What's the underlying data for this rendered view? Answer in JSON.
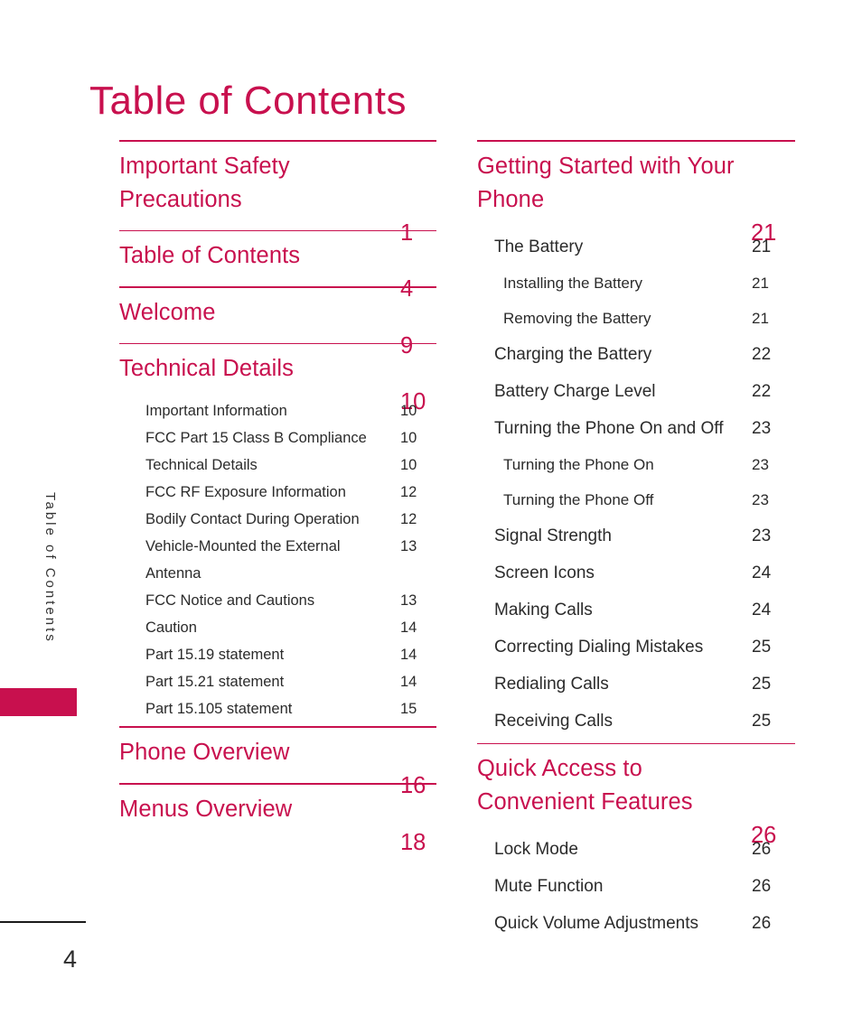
{
  "page": {
    "title": "Table of Contents",
    "side_tab_label": "Table of Contents",
    "folio": "4",
    "accent_color": "#C8104E",
    "text_color": "#2b2b2b"
  },
  "left_column": {
    "sections": [
      {
        "title": "Important Safety Precautions",
        "page": "1",
        "entries": []
      },
      {
        "title": "Table of Contents",
        "page": "4",
        "entries": []
      },
      {
        "title": "Welcome",
        "page": "9",
        "entries": []
      },
      {
        "title": "Technical Details",
        "page": "10",
        "entries": [
          {
            "label": "Important Information",
            "page": "10"
          },
          {
            "label": "FCC Part 15 Class B Compliance",
            "page": "10"
          },
          {
            "label": "Technical Details",
            "page": "10"
          },
          {
            "label": "FCC RF Exposure Information",
            "page": "12"
          },
          {
            "label": "Bodily Contact During Operation",
            "page": "12"
          },
          {
            "label": "Vehicle-Mounted the External Antenna",
            "page": "13"
          },
          {
            "label": "FCC Notice and Cautions",
            "page": "13"
          },
          {
            "label": "Caution",
            "page": "14"
          },
          {
            "label": "Part 15.19 statement",
            "page": "14"
          },
          {
            "label": "Part 15.21 statement",
            "page": "14"
          },
          {
            "label": "Part 15.105 statement",
            "page": "15"
          }
        ]
      },
      {
        "title": "Phone Overview",
        "page": "16",
        "entries": []
      },
      {
        "title": "Menus Overview",
        "page": "18",
        "entries": []
      }
    ]
  },
  "right_column": {
    "sections": [
      {
        "title": "Getting Started with Your Phone",
        "page": "21",
        "entries": [
          {
            "label": "The Battery",
            "page": "21",
            "level": 1
          },
          {
            "label": "Installing the Battery",
            "page": "21",
            "level": 2
          },
          {
            "label": "Removing the Battery",
            "page": "21",
            "level": 2
          },
          {
            "label": "Charging the Battery",
            "page": "22",
            "level": 1
          },
          {
            "label": "Battery Charge Level",
            "page": "22",
            "level": 1
          },
          {
            "label": "Turning the Phone On and Off",
            "page": "23",
            "level": 1
          },
          {
            "label": "Turning the Phone On",
            "page": "23",
            "level": 2
          },
          {
            "label": "Turning the Phone Off",
            "page": "23",
            "level": 2
          },
          {
            "label": "Signal Strength",
            "page": "23",
            "level": 1
          },
          {
            "label": "Screen Icons",
            "page": "24",
            "level": 1
          },
          {
            "label": "Making Calls",
            "page": "24",
            "level": 1
          },
          {
            "label": "Correcting Dialing Mistakes",
            "page": "25",
            "level": 1
          },
          {
            "label": "Redialing Calls",
            "page": "25",
            "level": 1
          },
          {
            "label": "Receiving Calls",
            "page": "25",
            "level": 1
          }
        ]
      },
      {
        "title": "Quick Access to Convenient Features",
        "page": "26",
        "entries": [
          {
            "label": "Lock Mode",
            "page": "26",
            "level": 1
          },
          {
            "label": "Mute Function",
            "page": "26",
            "level": 1
          },
          {
            "label": "Quick Volume Adjustments",
            "page": "26",
            "level": 1
          }
        ]
      }
    ]
  }
}
